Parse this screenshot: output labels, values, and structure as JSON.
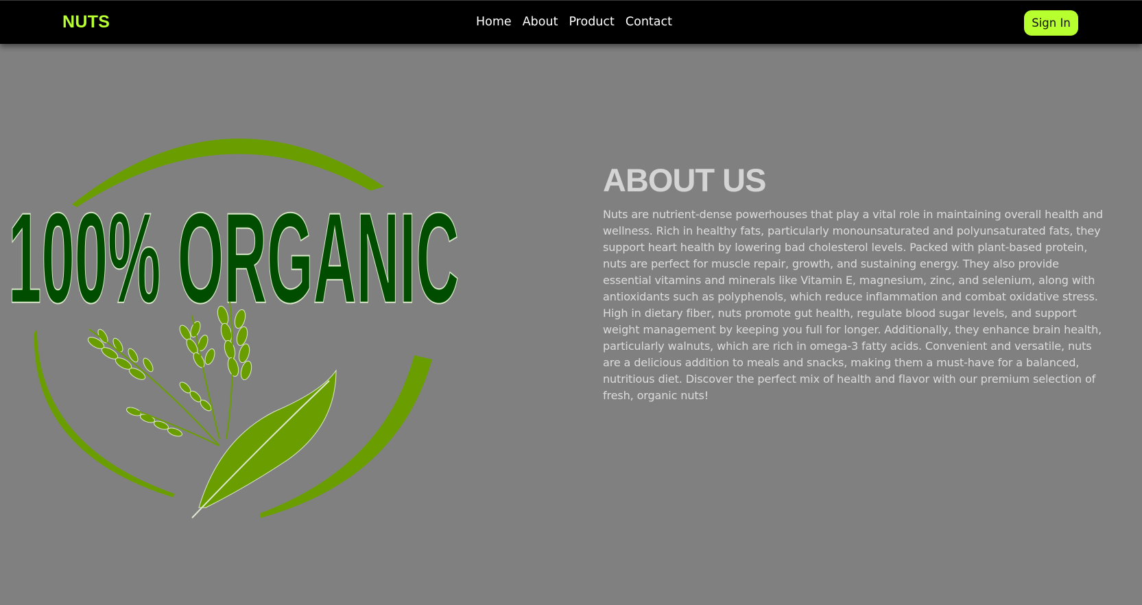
{
  "navbar": {
    "brand": "NUTS",
    "links": [
      {
        "label": "Home"
      },
      {
        "label": "About"
      },
      {
        "label": "Product"
      },
      {
        "label": "Contact"
      }
    ],
    "signin_label": "Sign In"
  },
  "logo": {
    "text": "100% ORGANIC",
    "icon": "organic-wheat-leaf-icon"
  },
  "about": {
    "title": "ABOUT US",
    "body": "Nuts are nutrient-dense powerhouses that play a vital role in maintaining overall health and wellness. Rich in healthy fats, particularly monounsaturated and polyunsaturated fats, they support heart health by lowering bad cholesterol levels. Packed with plant-based protein, nuts are perfect for muscle repair, growth, and sustaining energy. They also provide essential vitamins and minerals like Vitamin E, magnesium, zinc, and selenium, along with antioxidants such as polyphenols, which reduce inflammation and combat oxidative stress. High in dietary fiber, nuts promote gut health, regulate blood sugar levels, and support weight management by keeping you full for longer. Additionally, they enhance brain health, particularly walnuts, which are rich in omega-3 fatty acids. Convenient and versatile, nuts are a delicious addition to meals and snacks, making them a must-have for a balanced, nutritious diet. Discover the perfect mix of health and flavor with our premium selection of fresh, organic nuts!"
  },
  "colors": {
    "accent": "#b8ff2f",
    "navbar_bg": "#000000",
    "page_bg": "#808080",
    "logo_dark_green": "#004d00",
    "logo_light_green": "#6a9e00"
  }
}
